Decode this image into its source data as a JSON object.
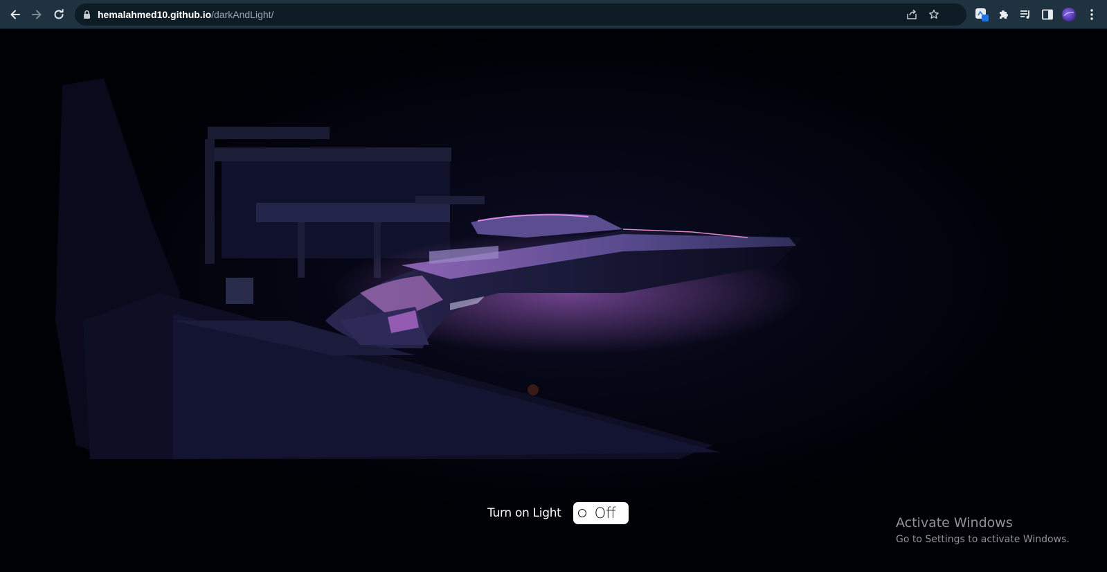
{
  "browser": {
    "url_host": "hemalahmed10.github.io",
    "url_path": "/darkAndLight/",
    "nav_icons": [
      "back-arrow-icon",
      "forward-arrow-icon",
      "reload-icon"
    ],
    "omnibox_icons": [
      "share-icon",
      "bookmark-star-icon"
    ],
    "toolbar_icons": [
      "extension-app-icon",
      "puzzle-icon",
      "reading-list-icon",
      "side-panel-icon",
      "profile-avatar",
      "kebab-menu-icon"
    ],
    "colors": {
      "toolbar": "#1f3240",
      "omnibox": "#0e1c25"
    }
  },
  "page": {
    "background": "#000105",
    "light_control": {
      "label": "Turn on Light",
      "toggle_state": "Off"
    }
  },
  "watermark": {
    "title": "Activate Windows",
    "subtitle": "Go to Settings to activate Windows."
  }
}
